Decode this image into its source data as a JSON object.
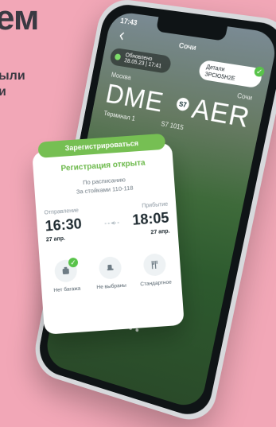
{
  "ad": {
    "headline_fragment": "ем",
    "subtext_lines": [
      "ыли",
      "и"
    ]
  },
  "phone": {
    "status": {
      "time": "17:43"
    },
    "header": {
      "title": "Сочи"
    },
    "pills": {
      "update": {
        "line1": "Обновлено",
        "line2": "28.05.23 | 17:41"
      },
      "details": {
        "line1": "Детали",
        "line2": "ЗРСЮ5Н2Е"
      }
    },
    "route": {
      "from_city": "Москва",
      "to_city": "Сочи",
      "from_code": "DME",
      "to_code": "AER",
      "airline_code": "S7",
      "terminal": "Терминал 1",
      "flight": "S7 1015"
    },
    "card": {
      "cta": "Зарегистрироваться",
      "heading": "Регистрация открыта",
      "sub_line1": "По расписанию",
      "sub_line2": "За стойками 110-118",
      "departure": {
        "label": "Отправление",
        "time": "16:30",
        "date": "27 апр."
      },
      "arrival": {
        "label": "Прибытие",
        "time": "18:05",
        "date": "27 апр."
      },
      "options": [
        {
          "icon": "baggage-icon",
          "label": "Нет багажа"
        },
        {
          "icon": "seat-icon",
          "label": "Не выбраны"
        },
        {
          "icon": "meal-icon",
          "label": "Стандартное"
        }
      ]
    },
    "pager": {
      "total": 3,
      "active_index": 0
    }
  },
  "colors": {
    "background": "#f2a7b7",
    "text_dark": "#3a3942",
    "accent_green": "#76bf53"
  }
}
